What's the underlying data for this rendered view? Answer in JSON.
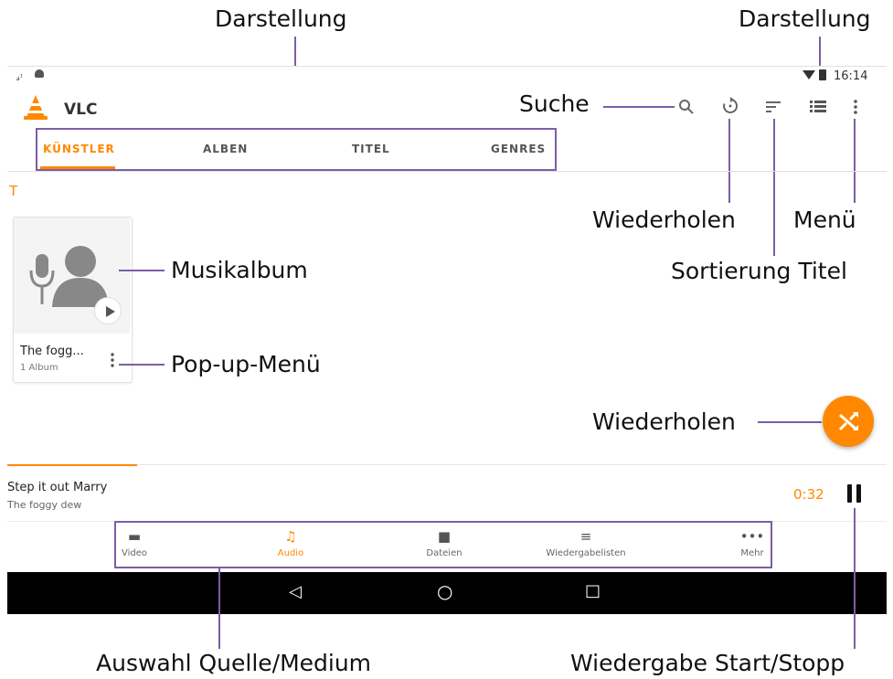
{
  "colors": {
    "accent": "#ff8800",
    "annotation": "#7b5ea7",
    "navbar": "#000000"
  },
  "annotations": {
    "darstellung_tabs": "Darstellung",
    "darstellung_view": "Darstellung",
    "suche": "Suche",
    "wiederholen_top": "Wiederholen",
    "menue": "Menü",
    "sortierung": "Sortierung Titel",
    "musikalbum": "Musikalbum",
    "popup_menue": "Pop-up-Menü",
    "wiederholen_fab": "Wiederholen",
    "auswahl": "Auswahl Quelle/Medium",
    "wiedergabe": "Wiedergabe Start/Stopp"
  },
  "status_bar": {
    "time": "16:14",
    "left_icons": "ꟷ ⚙"
  },
  "app": {
    "title": "VLC"
  },
  "tabs": [
    "KÜNSTLER",
    "ALBEN",
    "TITEL",
    "GENRES"
  ],
  "section_letter": "T",
  "album_card": {
    "title": "The fogg...",
    "subtitle": "1 Album"
  },
  "now_playing": {
    "title": "Step it out Marry",
    "artist": "The foggy dew",
    "time": "0:32"
  },
  "bottom_nav": [
    {
      "label": "Video",
      "icon": "clapper-icon"
    },
    {
      "label": "Audio",
      "icon": "music-note-icon"
    },
    {
      "label": "Dateien",
      "icon": "folder-icon"
    },
    {
      "label": "Wiedergabelisten",
      "icon": "playlist-icon"
    },
    {
      "label": "Mehr",
      "icon": "more-horizontal-icon"
    }
  ],
  "system_nav": {
    "back": "◁",
    "home": "○",
    "recents": "□"
  }
}
